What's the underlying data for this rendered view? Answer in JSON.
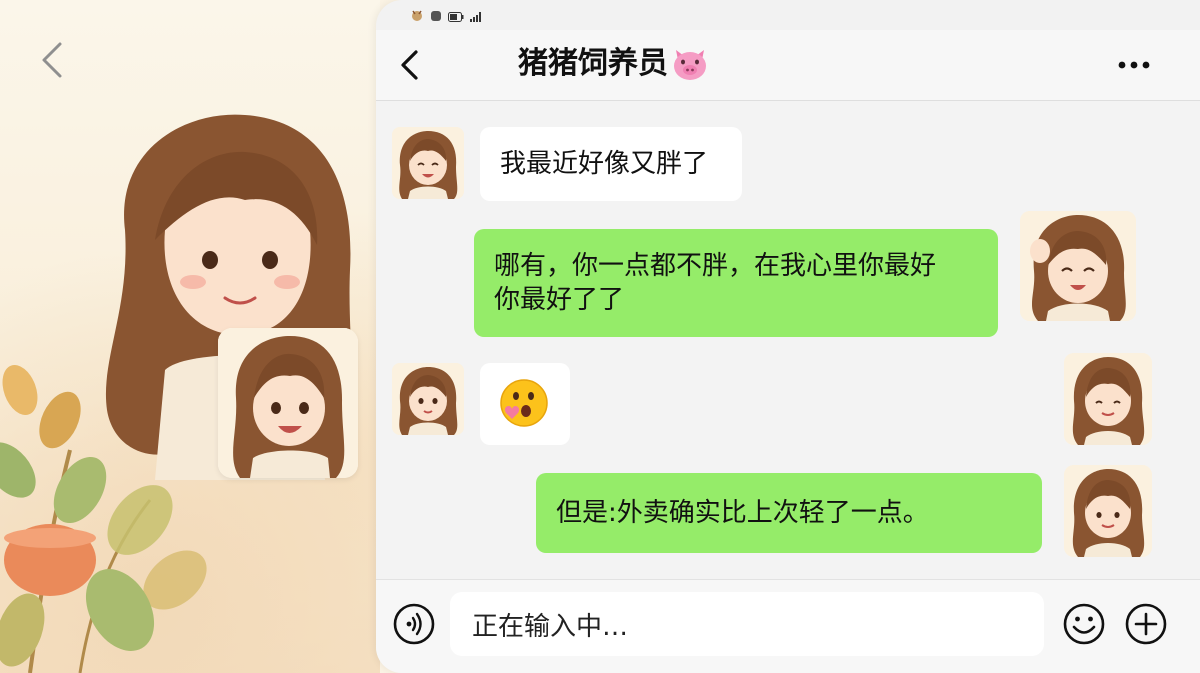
{
  "header": {
    "title": "猪猪饲养员",
    "title_icon": "pig-face-icon",
    "back_icon": "chevron-left-icon",
    "more_icon": "more-dots-icon"
  },
  "status_bar": {
    "icons": [
      "deer-icon",
      "app-icon",
      "battery-icon",
      "signal-icon"
    ]
  },
  "messages": [
    {
      "side": "left",
      "text": "我最近好像又胖了",
      "avatar": "girl-avatar"
    },
    {
      "side": "right",
      "text": "哪有，你一点都不胖，在我心里你最好\n你最好了了",
      "avatar": "girl-avatar"
    },
    {
      "side": "left",
      "text": "😮",
      "avatar": "girl-avatar",
      "is_emoji": true
    },
    {
      "side": "right",
      "text": "",
      "avatar": "girl-avatar"
    },
    {
      "side": "right",
      "text": "但是:外卖确实比上次轻了一点。",
      "avatar": "girl-avatar"
    }
  ],
  "input": {
    "value": "正在输入中…",
    "voice_icon": "voice-icon",
    "emoji_icon": "smiley-icon",
    "plus_icon": "plus-circle-icon"
  },
  "colors": {
    "bubble_sent": "#95ec69",
    "bubble_received": "#ffffff",
    "background": "#f3f3f3"
  }
}
